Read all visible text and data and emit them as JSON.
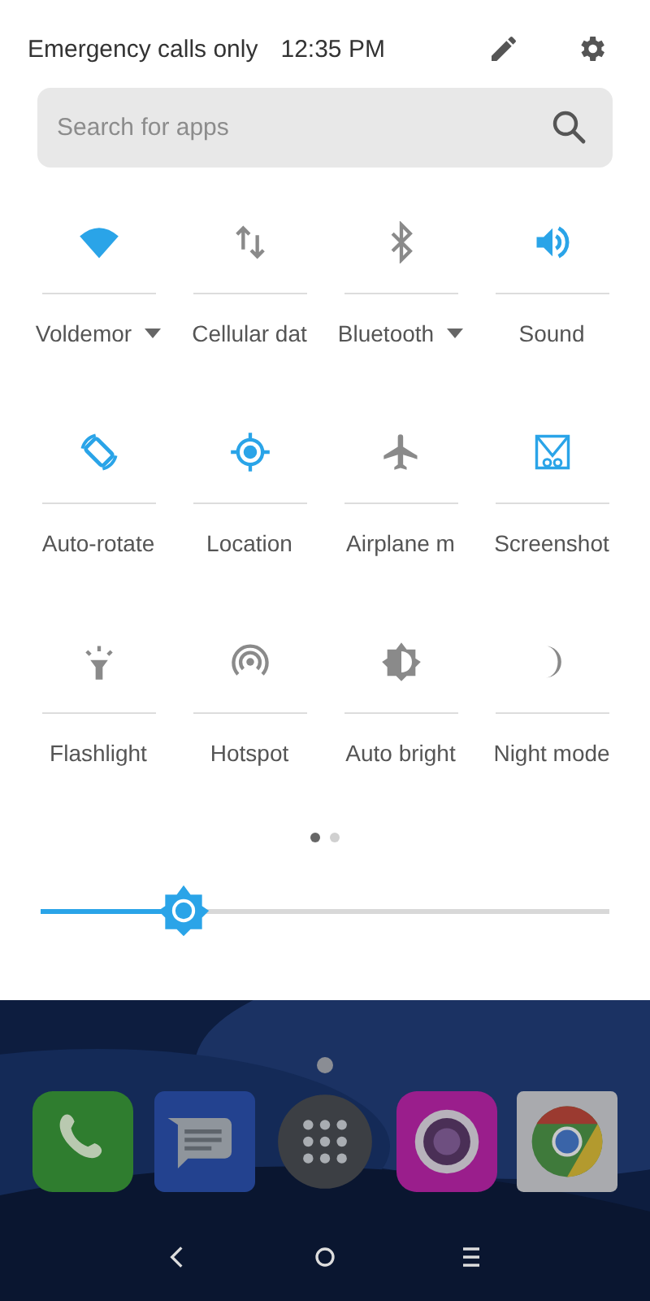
{
  "status_bar": {
    "carrier": "Emergency calls only",
    "time": "12:35 PM"
  },
  "search": {
    "placeholder": "Search for apps"
  },
  "tiles": [
    {
      "kind": "wifi",
      "label": "Voldemor",
      "on": true,
      "dropdown": true
    },
    {
      "kind": "data",
      "label": "Cellular dat",
      "on": false,
      "dropdown": false
    },
    {
      "kind": "bluetooth",
      "label": "Bluetooth",
      "on": false,
      "dropdown": true
    },
    {
      "kind": "sound",
      "label": "Sound",
      "on": true,
      "dropdown": false
    },
    {
      "kind": "rotate",
      "label": "Auto-rotate",
      "on": true,
      "dropdown": false
    },
    {
      "kind": "location",
      "label": "Location",
      "on": true,
      "dropdown": false
    },
    {
      "kind": "airplane",
      "label": "Airplane m",
      "on": false,
      "dropdown": false
    },
    {
      "kind": "screenshot",
      "label": "Screenshot",
      "on": true,
      "dropdown": false
    },
    {
      "kind": "flashlight",
      "label": "Flashlight",
      "on": false,
      "dropdown": false
    },
    {
      "kind": "hotspot",
      "label": "Hotspot",
      "on": false,
      "dropdown": false
    },
    {
      "kind": "brightness",
      "label": "Auto bright",
      "on": false,
      "dropdown": false
    },
    {
      "kind": "night",
      "label": "Night mode",
      "on": false,
      "dropdown": false
    }
  ],
  "pages": [
    {
      "selected": true
    },
    {
      "selected": false
    }
  ],
  "brightness": {
    "level": 0.25
  },
  "dock": [
    {
      "kind": "phone"
    },
    {
      "kind": "messages"
    },
    {
      "kind": "apps"
    },
    {
      "kind": "camera"
    },
    {
      "kind": "browser"
    }
  ],
  "nav": [
    {
      "kind": "back"
    },
    {
      "kind": "home"
    },
    {
      "kind": "recents"
    }
  ]
}
